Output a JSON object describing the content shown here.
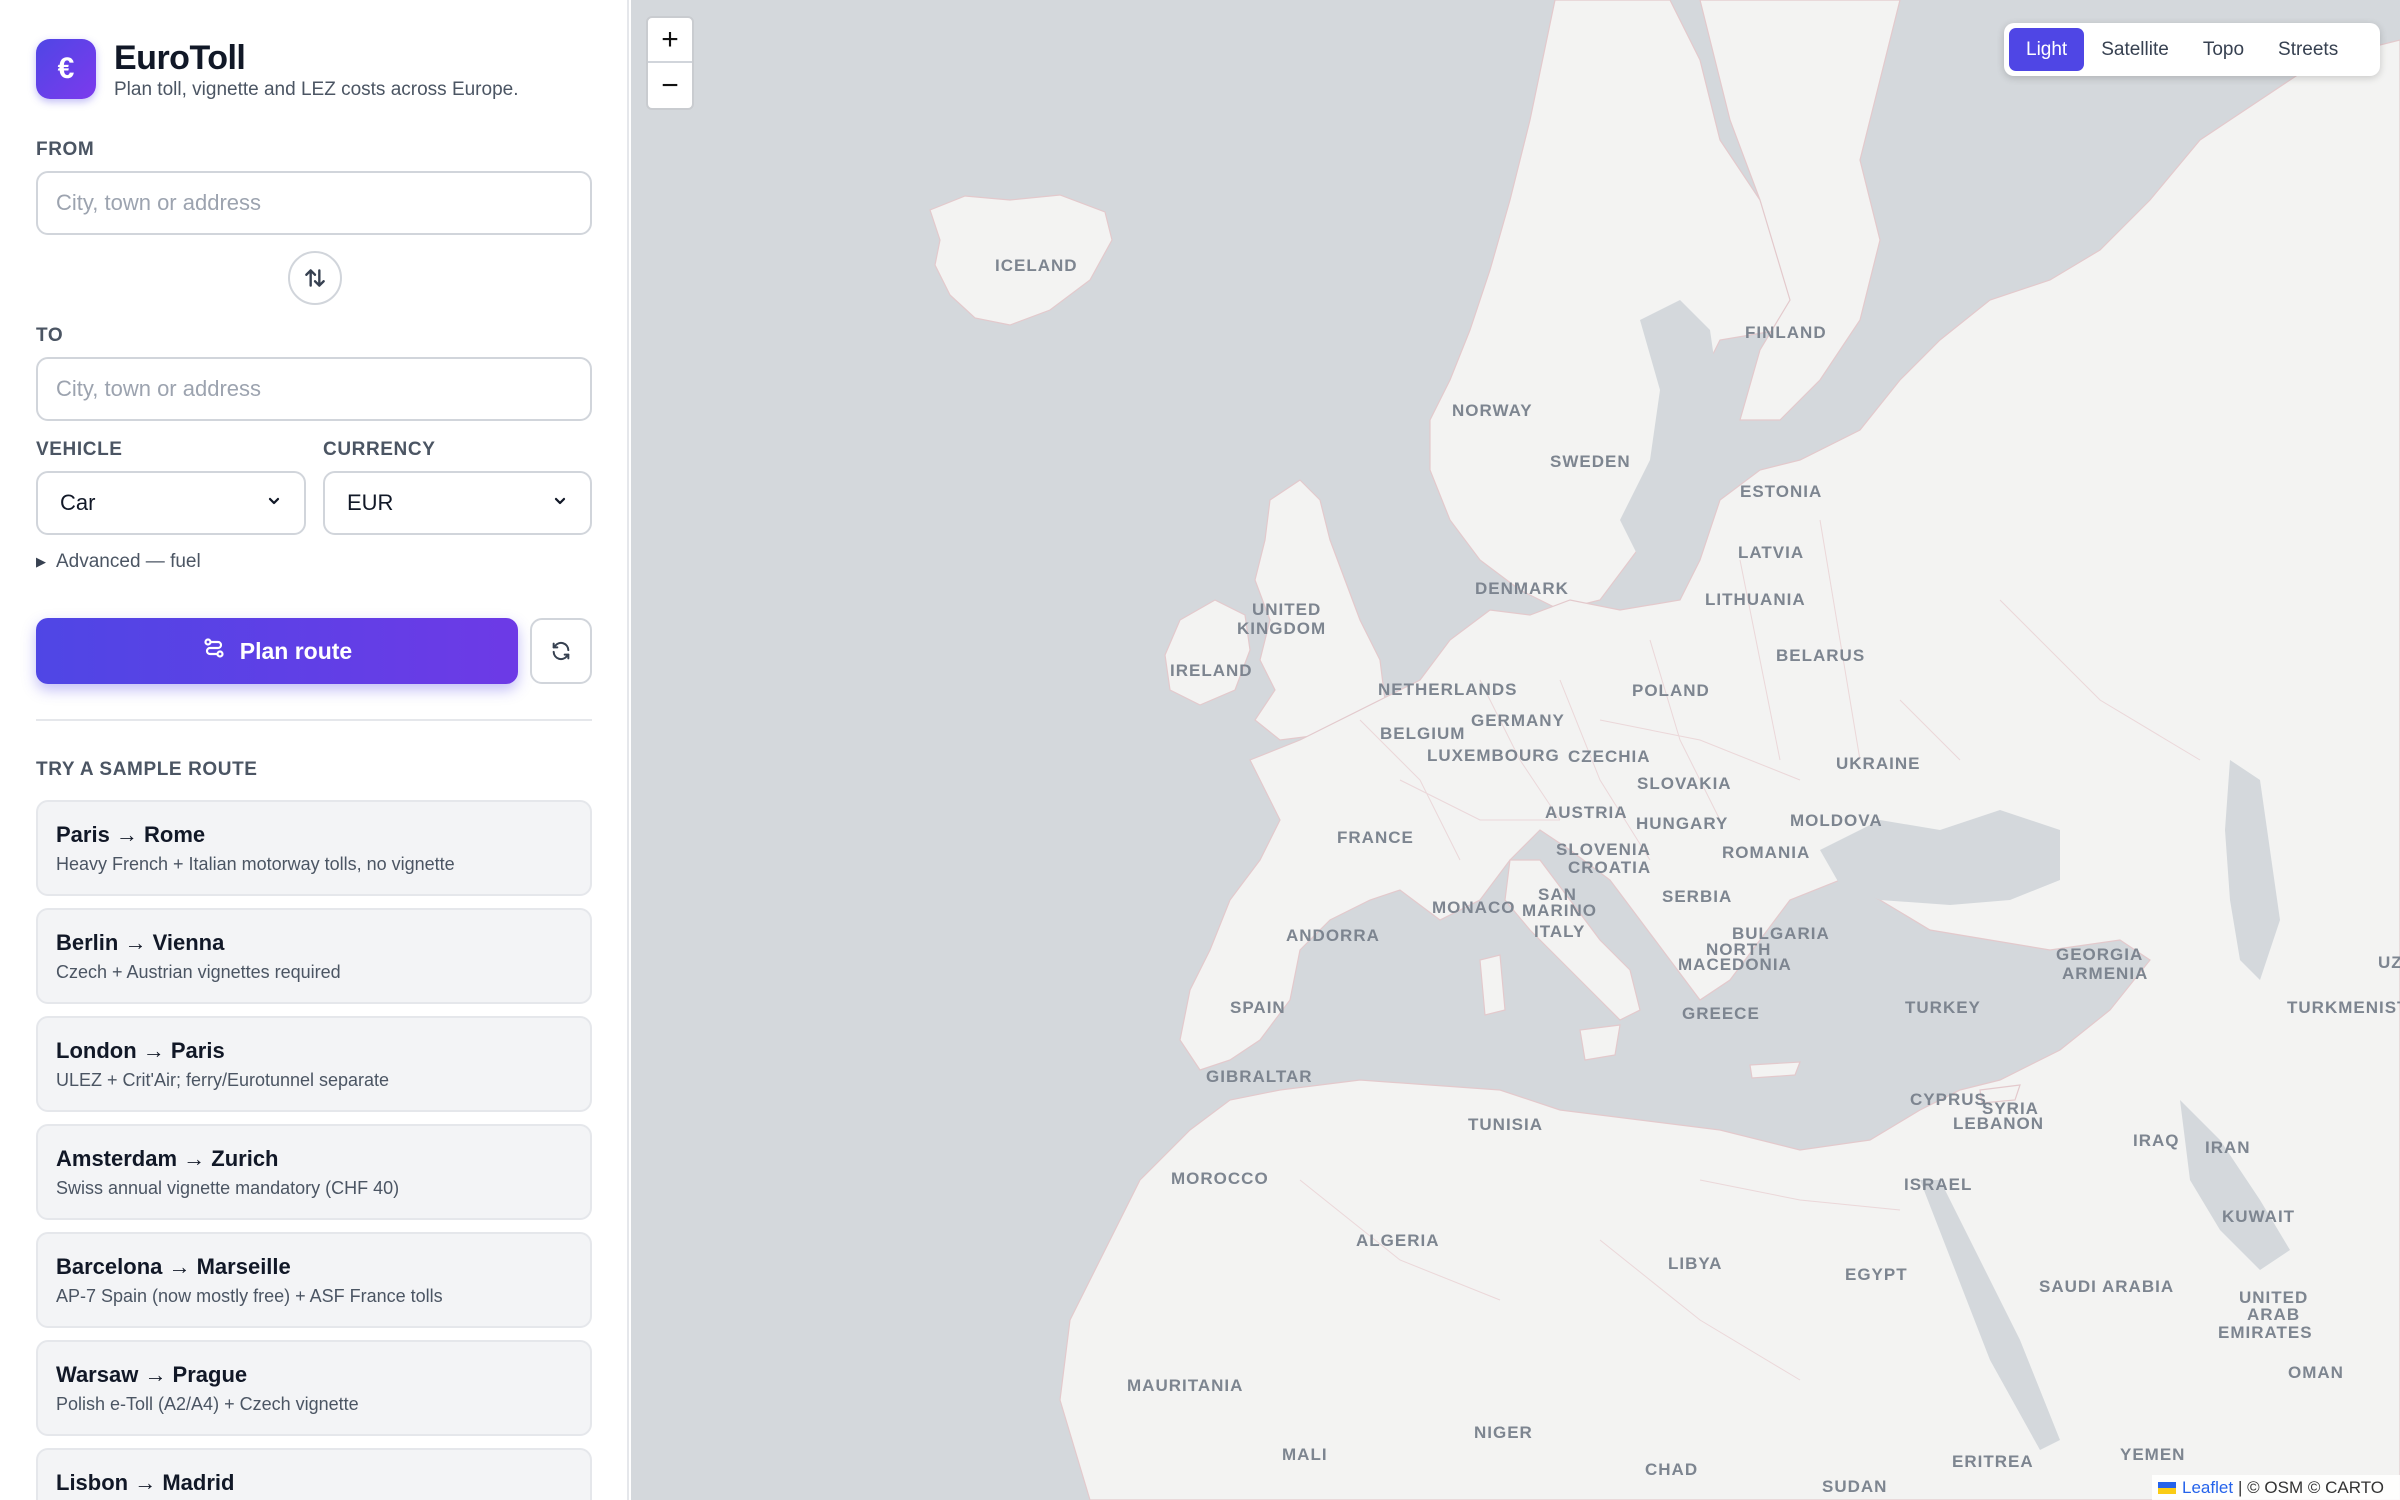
{
  "brand": {
    "logo_glyph": "€",
    "title": "EuroToll",
    "subtitle": "Plan toll, vignette and LEZ costs across Europe.",
    "accent_color": "#4f46e5"
  },
  "form": {
    "from_label": "FROM",
    "from_placeholder": "City, town or address",
    "to_label": "TO",
    "to_placeholder": "City, town or address",
    "vehicle_label": "VEHICLE",
    "vehicle_value": "Car",
    "currency_label": "CURRENCY",
    "currency_value": "EUR",
    "advanced_label": "Advanced — fuel",
    "plan_button": "Plan route",
    "swap_icon": "swap-vertical-icon",
    "reset_icon": "refresh-icon"
  },
  "samples": {
    "label": "TRY A SAMPLE ROUTE",
    "items": [
      {
        "title": "Paris → Rome",
        "desc": "Heavy French + Italian motorway tolls, no vignette"
      },
      {
        "title": "Berlin → Vienna",
        "desc": "Czech + Austrian vignettes required"
      },
      {
        "title": "London → Paris",
        "desc": "ULEZ + Crit'Air; ferry/Eurotunnel separate"
      },
      {
        "title": "Amsterdam → Zurich",
        "desc": "Swiss annual vignette mandatory (CHF 40)"
      },
      {
        "title": "Barcelona → Marseille",
        "desc": "AP-7 Spain (now mostly free) + ASF France tolls"
      },
      {
        "title": "Warsaw → Prague",
        "desc": "Polish e-Toll (A2/A4) + Czech vignette"
      },
      {
        "title": "Lisbon → Madrid",
        "desc": ""
      }
    ]
  },
  "map": {
    "zoom_in": "+",
    "zoom_out": "−",
    "layers": [
      "Light",
      "Satellite",
      "Topo",
      "Streets"
    ],
    "active_layer": "Light",
    "attribution_leaflet": "Leaflet",
    "attribution_rest": " | © OSM © CARTO",
    "labels": [
      {
        "text": "ICELAND"
      },
      {
        "text": "FINLAND"
      },
      {
        "text": "NORWAY"
      },
      {
        "text": "SWEDEN"
      },
      {
        "text": "ESTONIA"
      },
      {
        "text": "LATVIA"
      },
      {
        "text": "LITHUANIA"
      },
      {
        "text": "DENMARK"
      },
      {
        "text": "UNITED"
      },
      {
        "text": "KINGDOM"
      },
      {
        "text": "IRELAND"
      },
      {
        "text": "BELARUS"
      },
      {
        "text": "NETHERLANDS"
      },
      {
        "text": "POLAND"
      },
      {
        "text": "GERMANY"
      },
      {
        "text": "BELGIUM"
      },
      {
        "text": "LUXEMBOURG"
      },
      {
        "text": "CZECHIA"
      },
      {
        "text": "UKRAINE"
      },
      {
        "text": "SLOVAKIA"
      },
      {
        "text": "AUSTRIA"
      },
      {
        "text": "HUNGARY"
      },
      {
        "text": "MOLDOVA"
      },
      {
        "text": "FRANCE"
      },
      {
        "text": "SLOVENIA"
      },
      {
        "text": "CROATIA"
      },
      {
        "text": "ROMANIA"
      },
      {
        "text": "SERBIA"
      },
      {
        "text": "SAN"
      },
      {
        "text": "MARINO"
      },
      {
        "text": "MONACO"
      },
      {
        "text": "ITALY"
      },
      {
        "text": "ANDORRA"
      },
      {
        "text": "BULGARIA"
      },
      {
        "text": "NORTH"
      },
      {
        "text": "MACEDONIA"
      },
      {
        "text": "GEORGIA"
      },
      {
        "text": "ARMENIA"
      },
      {
        "text": "SPAIN"
      },
      {
        "text": "GREECE"
      },
      {
        "text": "TURKEY"
      },
      {
        "text": "TURKMENIST"
      },
      {
        "text": "GIBRALTAR"
      },
      {
        "text": "TUNISIA"
      },
      {
        "text": "CYPRUS"
      },
      {
        "text": "SYRIA"
      },
      {
        "text": "LEBANON"
      },
      {
        "text": "IRAQ"
      },
      {
        "text": "IRAN"
      },
      {
        "text": "MOROCCO"
      },
      {
        "text": "ISRAEL"
      },
      {
        "text": "KUWAIT"
      },
      {
        "text": "ALGERIA"
      },
      {
        "text": "LIBYA"
      },
      {
        "text": "EGYPT"
      },
      {
        "text": "SAUDI ARABIA"
      },
      {
        "text": "UNITED"
      },
      {
        "text": "ARAB"
      },
      {
        "text": "EMIRATES"
      },
      {
        "text": "OMAN"
      },
      {
        "text": "MAURITANIA"
      },
      {
        "text": "NIGER"
      },
      {
        "text": "MALI"
      },
      {
        "text": "CHAD"
      },
      {
        "text": "ERITREA"
      },
      {
        "text": "YEMEN"
      },
      {
        "text": "SUDAN"
      },
      {
        "text": "UZ"
      }
    ]
  }
}
